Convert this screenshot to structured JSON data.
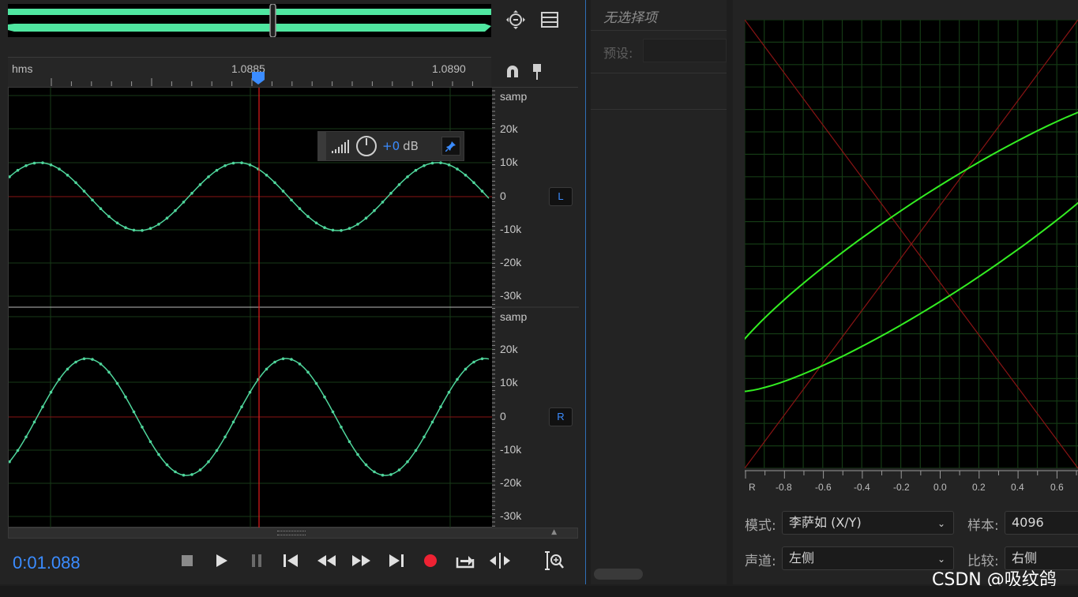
{
  "ruler": {
    "unit": "hms",
    "ticks": [
      {
        "label": "1.0885",
        "x": 317
      },
      {
        "label": "1.0890",
        "x": 571
      }
    ]
  },
  "tracks": {
    "left": {
      "channel": "L",
      "amp_labels": [
        "samp",
        "20k",
        "10k",
        "0",
        "-10k",
        "-20k",
        "-30k"
      ]
    },
    "right": {
      "channel": "R",
      "amp_labels": [
        "samp",
        "20k",
        "10k",
        "0",
        "-10k",
        "-20k",
        "-30k"
      ]
    }
  },
  "hud": {
    "gain_sign": "+0",
    "gain_unit": "dB"
  },
  "transport": {
    "timecode": "0:01.088",
    "buttons": [
      "stop",
      "play",
      "pause",
      "skip-to-start",
      "rewind",
      "fast-forward",
      "skip-to-end",
      "record",
      "loop",
      "skip-selection"
    ]
  },
  "properties": {
    "no_selection": "无选择项",
    "preset_label": "预设:"
  },
  "phase_meter": {
    "x_ticks": [
      "R",
      "-0.8",
      "-0.6",
      "-0.4",
      "-0.2",
      "0.0",
      "0.2",
      "0.4",
      "0.6"
    ],
    "mode_label": "模式:",
    "mode_value": "李萨如 (X/Y)",
    "samples_label": "样本:",
    "samples_value": "4096",
    "channel_label": "声道:",
    "channel_value": "左侧",
    "compare_label": "比较:",
    "compare_value": "右侧"
  },
  "watermark": "CSDN @吸纹鸽",
  "colors": {
    "waveform": "#4fd69c",
    "playhead": "#e21b1b",
    "accent": "#3b8cff",
    "lissajous": "#33ee22",
    "grid": "#143a14"
  }
}
